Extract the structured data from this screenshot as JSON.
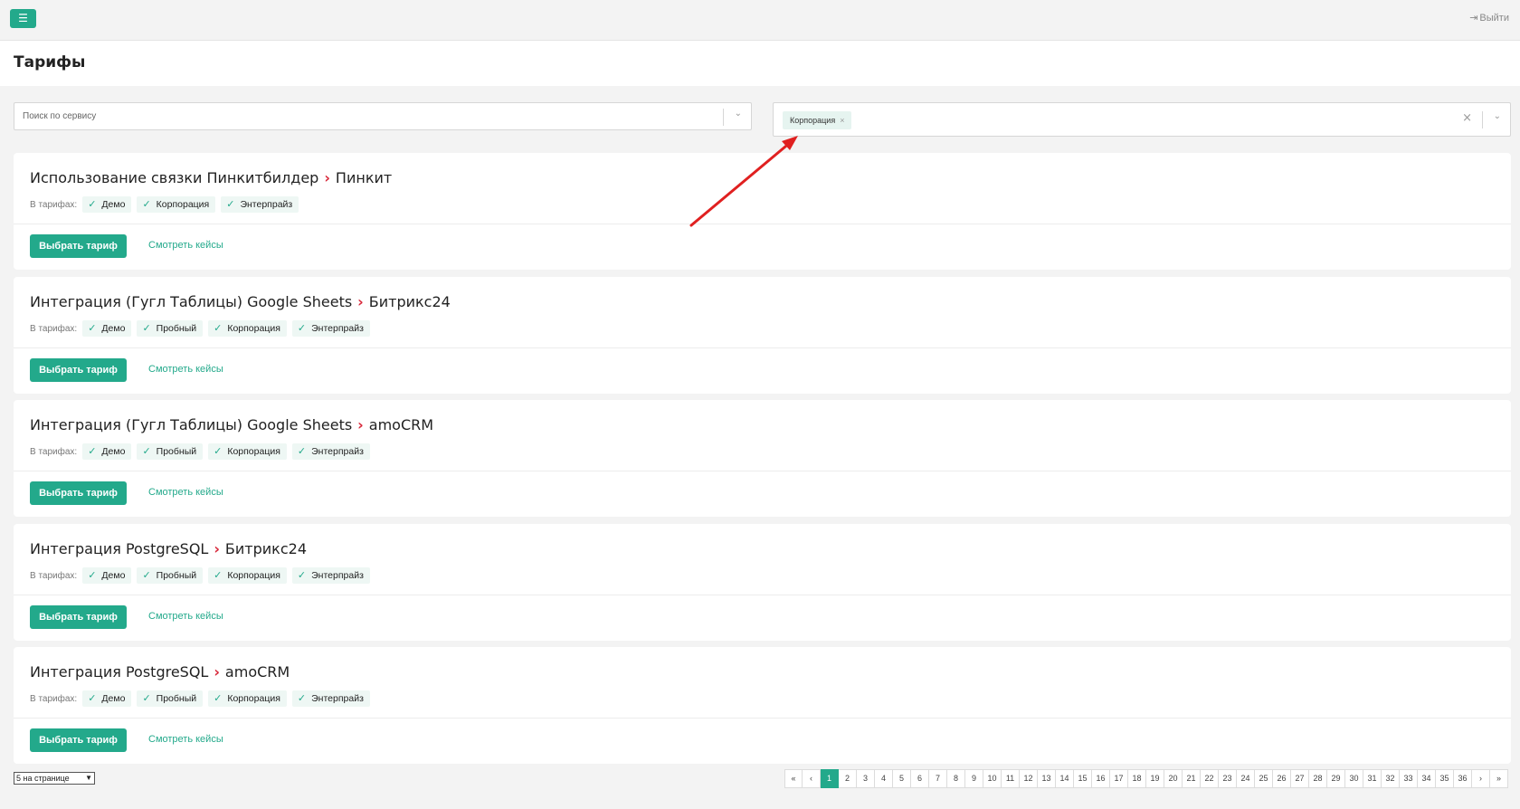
{
  "topbar": {
    "menu_icon": "☰",
    "logout_label": "Выйти"
  },
  "page": {
    "title": "Тарифы"
  },
  "search": {
    "placeholder": "Поиск по сервису"
  },
  "filter": {
    "chips": [
      "Корпорация"
    ]
  },
  "card_common": {
    "tariffs_label": "В тарифах:",
    "choose_label": "Выбрать тариф",
    "cases_label": "Смотреть кейсы"
  },
  "cards": [
    {
      "from": "Использование связки Пинкитбилдер",
      "to": "Пинкит",
      "tariffs": [
        "Демо",
        "Корпорация",
        "Энтерпрайз"
      ]
    },
    {
      "from": "Интеграция (Гугл Таблицы) Google Sheets",
      "to": "Битрикс24",
      "tariffs": [
        "Демо",
        "Пробный",
        "Корпорация",
        "Энтерпрайз"
      ]
    },
    {
      "from": "Интеграция (Гугл Таблицы) Google Sheets",
      "to": "amoCRM",
      "tariffs": [
        "Демо",
        "Пробный",
        "Корпорация",
        "Энтерпрайз"
      ]
    },
    {
      "from": "Интеграция PostgreSQL",
      "to": "Битрикс24",
      "tariffs": [
        "Демо",
        "Пробный",
        "Корпорация",
        "Энтерпрайз"
      ]
    },
    {
      "from": "Интеграция PostgreSQL",
      "to": "amoCRM",
      "tariffs": [
        "Демо",
        "Пробный",
        "Корпорация",
        "Энтерпрайз"
      ]
    }
  ],
  "per_page": {
    "selected": "5 на странице"
  },
  "pagination": {
    "first": "«",
    "prev": "‹",
    "next": "›",
    "last": "»",
    "current": "1",
    "pages": [
      "1",
      "2",
      "3",
      "4",
      "5",
      "6",
      "7",
      "8",
      "9",
      "10",
      "11",
      "12",
      "13",
      "14",
      "15",
      "16",
      "17",
      "18",
      "19",
      "20",
      "21",
      "22",
      "23",
      "24",
      "25",
      "26",
      "27",
      "28",
      "29",
      "30",
      "31",
      "32",
      "33",
      "34",
      "35",
      "36"
    ]
  },
  "colors": {
    "accent": "#23a98b",
    "arrow": "#e02020",
    "title_arrow": "#d8283a"
  }
}
